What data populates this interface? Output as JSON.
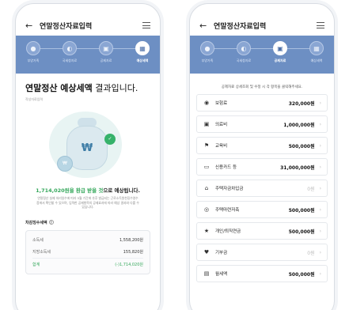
{
  "left": {
    "appbar": {
      "title": "연말정산자료입력"
    },
    "steps": [
      {
        "label": "부양가족",
        "icon": "people-icon",
        "glyph": "●"
      },
      {
        "label": "국세청자료",
        "icon": "document-icon",
        "glyph": "◐"
      },
      {
        "label": "공제자료",
        "icon": "deduction-icon",
        "glyph": "▣"
      },
      {
        "label": "예상세액",
        "icon": "calculator-icon",
        "glyph": "▦"
      }
    ],
    "active_step": 3,
    "result_title_bold": "연말정산 예상세액",
    "result_title_light": " 결과입니다.",
    "result_sub": "작성자료입력",
    "amount_green": "1,714,020원을 환급 받을 것",
    "amount_rest": "으로 예상됩니다.",
    "amount_sub": "연말정산 실제 처리일수에 따라 5월 기간에 추후 발급되는 근로소득원천징수영수증에서 확인할 수 있으며, 입력한 공제항목의 공제효과에 따라 예상 결과와 다를 수 있습니다.",
    "section_label": "차감징수세액",
    "tax_rows": [
      {
        "label": "소득세",
        "value": "1,558,200원"
      },
      {
        "label": "지방소득세",
        "value": "155,820원"
      },
      {
        "label": "합계",
        "value": "(-)1,714,020원"
      }
    ]
  },
  "right": {
    "appbar": {
      "title": "연말정산자료입력"
    },
    "steps": [
      {
        "label": "부양가족",
        "icon": "people-icon",
        "glyph": "●"
      },
      {
        "label": "국세청자료",
        "icon": "document-icon",
        "glyph": "◐"
      },
      {
        "label": "공제자료",
        "icon": "deduction-icon",
        "glyph": "▣"
      },
      {
        "label": "예상세액",
        "icon": "calculator-icon",
        "glyph": "▦"
      }
    ],
    "active_step": 2,
    "hint": "공제자료 상세조회 및 수정 시 각 항목을 클릭해주세요.",
    "items": [
      {
        "icon": "shield-icon",
        "glyph": "◉",
        "name": "보험료",
        "amount": "320,000원",
        "zero": false
      },
      {
        "icon": "hospital-icon",
        "glyph": "▣",
        "name": "의료비",
        "amount": "1,000,000원",
        "zero": false
      },
      {
        "icon": "graduation-icon",
        "glyph": "⚑",
        "name": "교육비",
        "amount": "500,000원",
        "zero": false
      },
      {
        "icon": "credit-card-icon",
        "glyph": "▭",
        "name": "신용카드 등",
        "amount": "31,000,000원",
        "zero": false
      },
      {
        "icon": "house-icon",
        "glyph": "⌂",
        "name": "주택자금차입금",
        "amount": "0원",
        "zero": true
      },
      {
        "icon": "piggy-bank-icon",
        "glyph": "◎",
        "name": "주택마련저축",
        "amount": "500,000원",
        "zero": false
      },
      {
        "icon": "pension-icon",
        "glyph": "★",
        "name": "개인/퇴직연금",
        "amount": "500,000원",
        "zero": false
      },
      {
        "icon": "donation-icon",
        "glyph": "♥",
        "name": "기부금",
        "amount": "0원",
        "zero": true
      },
      {
        "icon": "rent-icon",
        "glyph": "▤",
        "name": "월세액",
        "amount": "500,000원",
        "zero": false
      }
    ]
  }
}
